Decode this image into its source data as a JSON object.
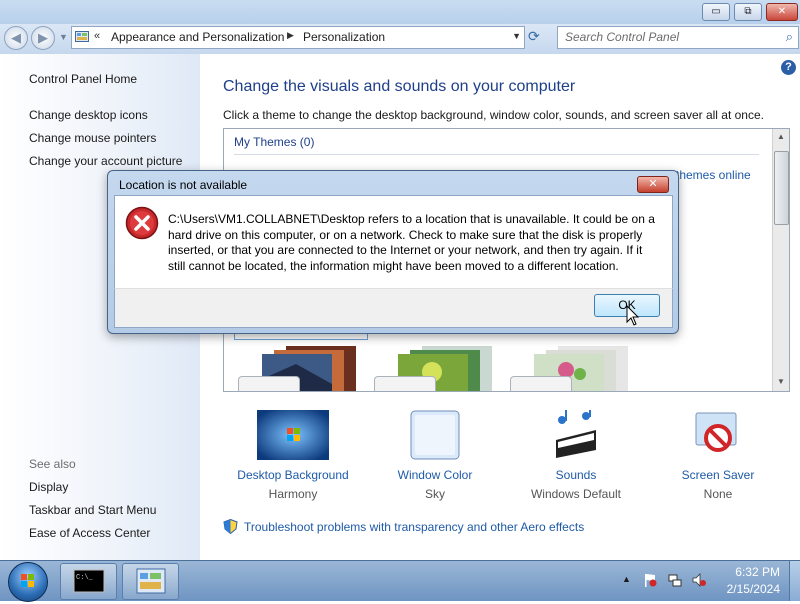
{
  "window": {
    "minimize_glyph": "▭",
    "maximize_glyph": "⧉",
    "close_glyph": "✕"
  },
  "nav": {
    "back_glyph": "◀",
    "forward_glyph": "▶",
    "chevron": "«",
    "crumb1": "Appearance and Personalization",
    "crumb_sep": "▶",
    "crumb2": "Personalization",
    "dropdown_glyph": "▼",
    "refresh_glyph": "⟳",
    "search_placeholder": "Search Control Panel",
    "search_icon": "⌕"
  },
  "sidebar": {
    "home": "Control Panel Home",
    "items": [
      {
        "label": "Change desktop icons"
      },
      {
        "label": "Change mouse pointers"
      },
      {
        "label": "Change your account picture"
      }
    ],
    "see_also": "See also",
    "see_also_items": [
      {
        "label": "Display"
      },
      {
        "label": "Taskbar and Start Menu"
      },
      {
        "label": "Ease of Access Center"
      }
    ]
  },
  "main": {
    "help_glyph": "?",
    "title": "Change the visuals and sounds on your computer",
    "subtitle": "Click a theme to change the desktop background, window color, sounds, and screen saver all at once.",
    "my_themes": "My Themes (0)",
    "get_more": "themes online",
    "options": [
      {
        "label": "Desktop Background",
        "value": "Harmony"
      },
      {
        "label": "Window Color",
        "value": "Sky"
      },
      {
        "label": "Sounds",
        "value": "Windows Default"
      },
      {
        "label": "Screen Saver",
        "value": "None"
      }
    ],
    "troubleshoot": "Troubleshoot problems with transparency and other Aero effects"
  },
  "dialog": {
    "title": "Location is not available",
    "close_glyph": "✕",
    "message": "C:\\Users\\VM1.COLLABNET\\Desktop refers to a location that is unavailable. It could be on a hard drive on this computer, or on a network. Check to make sure that the disk is properly inserted, or that you are connected to the Internet or your network, and then try again. If it still cannot be located, the information might have been moved to a different location.",
    "ok": "OK"
  },
  "taskbar": {
    "cmd_text": "C:\\_",
    "tray_up": "▲",
    "time": "6:32 PM",
    "date": "2/15/2024"
  },
  "colors": {
    "link": "#1e5aa8",
    "title": "#1e3f8a",
    "error_red": "#c6282b"
  }
}
